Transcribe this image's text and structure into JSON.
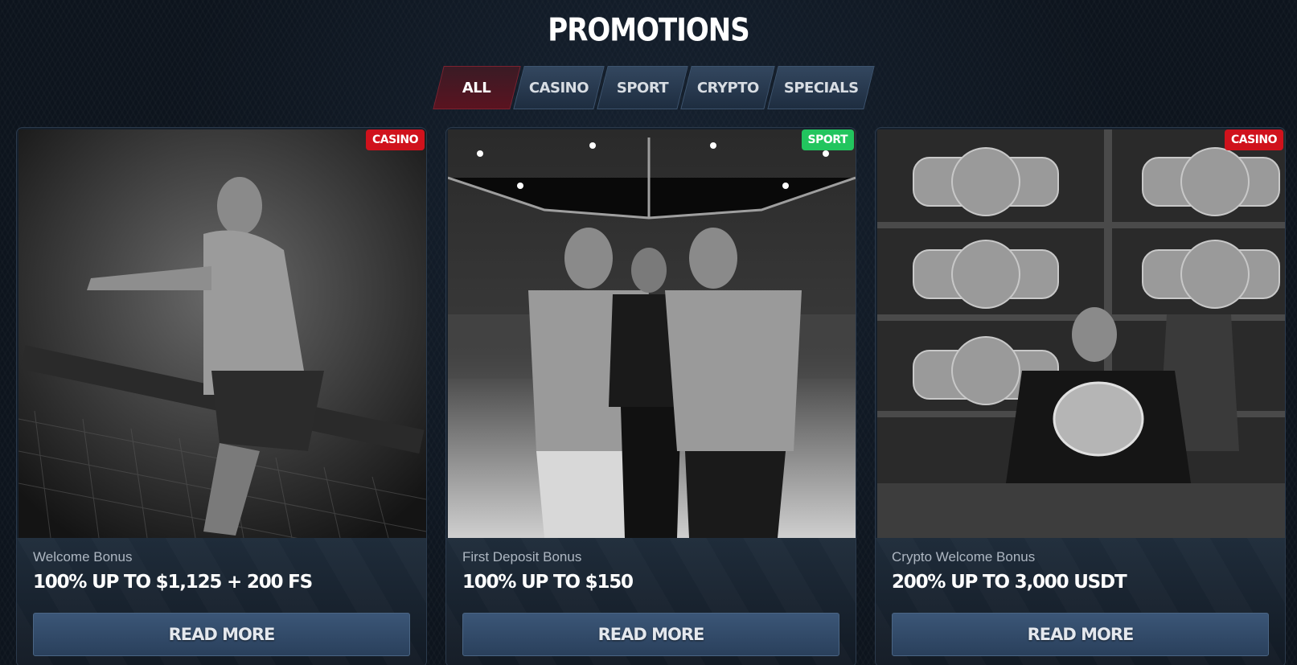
{
  "page": {
    "title": "PROMOTIONS"
  },
  "tabs": [
    {
      "label": "ALL",
      "active": true
    },
    {
      "label": "CASINO",
      "active": false
    },
    {
      "label": "SPORT",
      "active": false
    },
    {
      "label": "CRYPTO",
      "active": false
    },
    {
      "label": "SPECIALS",
      "active": false
    }
  ],
  "colors": {
    "background": "#0d141d",
    "badge_casino": "#d0121c",
    "badge_sport": "#22c55e",
    "tab_active": "#5a1320",
    "button": "#34506f"
  },
  "cards": [
    {
      "badge": "CASINO",
      "subtitle": "Welcome Bonus",
      "amount": "100% UP TO $1,125 + 200 FS",
      "button": "READ MORE",
      "image": "fighter-on-cage-photo"
    },
    {
      "badge": "SPORT",
      "subtitle": "First Deposit Bonus",
      "amount": "100% UP TO $150",
      "button": "READ MORE",
      "image": "fighters-faceoff-photo"
    },
    {
      "badge": "CASINO",
      "subtitle": "Crypto Welcome Bonus",
      "amount": "200% UP TO 3,000 USDT",
      "button": "READ MORE",
      "image": "champion-belts-photo"
    }
  ]
}
